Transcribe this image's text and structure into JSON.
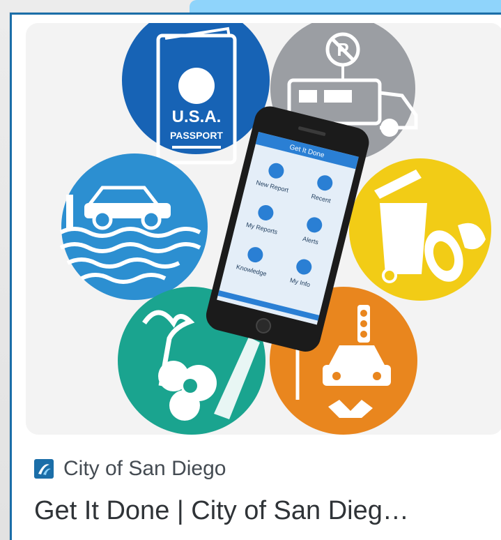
{
  "result": {
    "source": "City of San Diego",
    "title": "Get It Done | City of San Dieg…"
  },
  "image": {
    "passport_line1": "U.S.A.",
    "passport_line2": "PASSPORT",
    "phone_header": "Get It Done",
    "menu": [
      {
        "label": "New Report",
        "icon": "pencil-icon"
      },
      {
        "label": "Recent",
        "icon": "clock-icon"
      },
      {
        "label": "My Reports",
        "icon": "pen-icon"
      },
      {
        "label": "Alerts",
        "icon": "eye-icon"
      },
      {
        "label": "Knowledge",
        "icon": "info-icon"
      },
      {
        "label": "My Info",
        "icon": "person-icon"
      }
    ]
  },
  "colors": {
    "passport_blue": "#1763b5",
    "rv_gray": "#9b9ea3",
    "trash_yellow": "#f2cc16",
    "water_blue": "#2c8fd1",
    "park_teal": "#1aa48f",
    "street_orange": "#e9861e",
    "brand_blue": "#1b6ea8"
  }
}
